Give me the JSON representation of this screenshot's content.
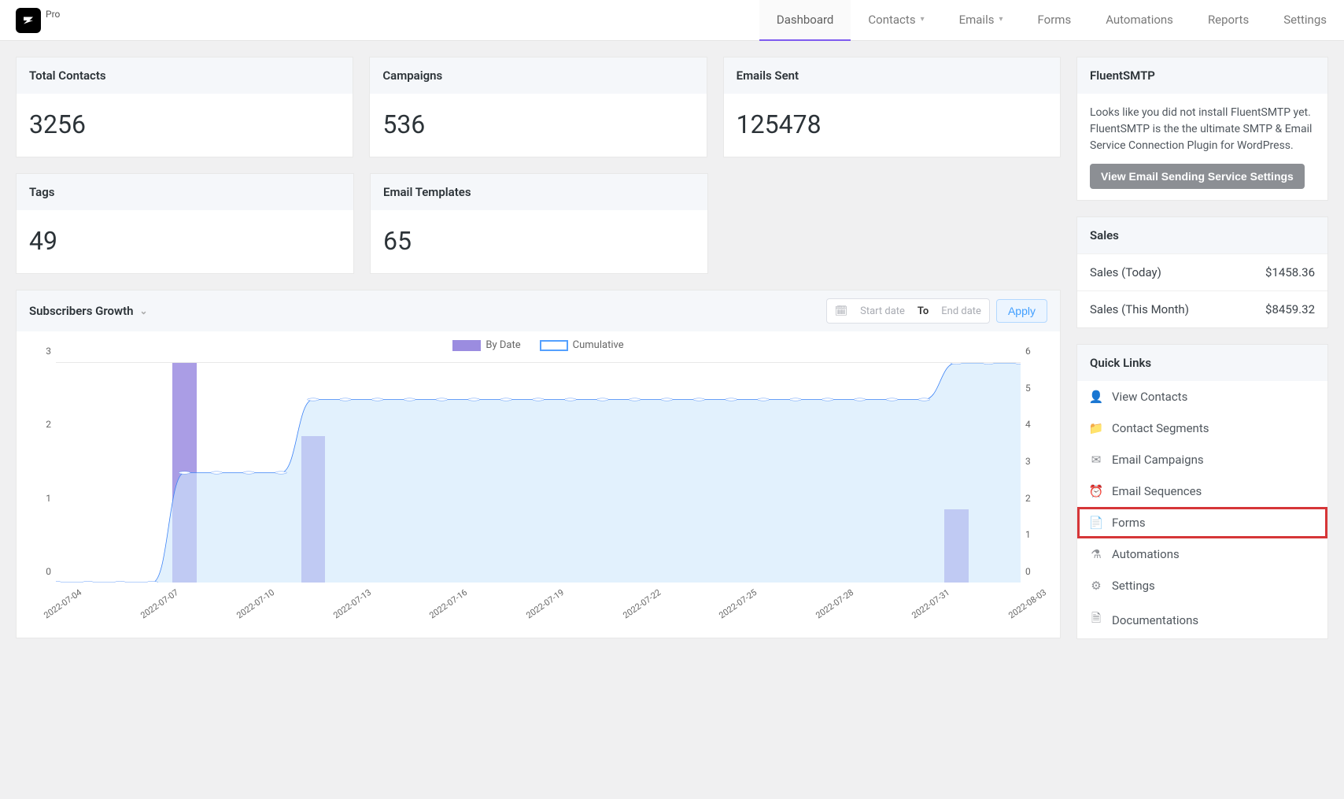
{
  "brand": {
    "pro": "Pro"
  },
  "nav": {
    "dashboard": "Dashboard",
    "contacts": "Contacts",
    "emails": "Emails",
    "forms": "Forms",
    "automations": "Automations",
    "reports": "Reports",
    "settings": "Settings"
  },
  "stats": {
    "total_contacts": {
      "label": "Total Contacts",
      "value": "3256"
    },
    "campaigns": {
      "label": "Campaigns",
      "value": "536"
    },
    "emails_sent": {
      "label": "Emails Sent",
      "value": "125478"
    },
    "tags": {
      "label": "Tags",
      "value": "49"
    },
    "email_templates": {
      "label": "Email Templates",
      "value": "65"
    }
  },
  "chart": {
    "title": "Subscribers Growth",
    "legend_bydate": "By Date",
    "legend_cumulative": "Cumulative",
    "start_placeholder": "Start date",
    "to": "To",
    "end_placeholder": "End date",
    "apply": "Apply"
  },
  "smtp": {
    "title": "FluentSMTP",
    "body": "Looks like you did not install FluentSMTP yet. FluentSMTP is the the ultimate SMTP & Email Service Connection Plugin for WordPress.",
    "button": "View Email Sending Service Settings"
  },
  "sales": {
    "title": "Sales",
    "today_label": "Sales (Today)",
    "today_value": "$1458.36",
    "month_label": "Sales (This Month)",
    "month_value": "$8459.32"
  },
  "quicklinks": {
    "title": "Quick Links",
    "view_contacts": "View Contacts",
    "contact_segments": "Contact Segments",
    "email_campaigns": "Email Campaigns",
    "email_sequences": "Email Sequences",
    "forms": "Forms",
    "automations": "Automations",
    "settings": "Settings",
    "documentations": "Documentations"
  },
  "chart_data": {
    "type": "bar+line",
    "x": [
      "2022-07-04",
      "2022-07-05",
      "2022-07-06",
      "2022-07-07",
      "2022-07-08",
      "2022-07-09",
      "2022-07-10",
      "2022-07-11",
      "2022-07-12",
      "2022-07-13",
      "2022-07-14",
      "2022-07-15",
      "2022-07-16",
      "2022-07-17",
      "2022-07-18",
      "2022-07-19",
      "2022-07-20",
      "2022-07-21",
      "2022-07-22",
      "2022-07-23",
      "2022-07-24",
      "2022-07-25",
      "2022-07-26",
      "2022-07-27",
      "2022-07-28",
      "2022-07-29",
      "2022-07-30",
      "2022-07-31",
      "2022-08-01",
      "2022-08-02",
      "2022-08-03"
    ],
    "x_ticks": [
      "2022-07-04",
      "2022-07-07",
      "2022-07-10",
      "2022-07-13",
      "2022-07-16",
      "2022-07-19",
      "2022-07-22",
      "2022-07-25",
      "2022-07-28",
      "2022-07-31",
      "2022-08-03"
    ],
    "series": [
      {
        "name": "By Date",
        "type": "bar",
        "yaxis": "left",
        "values": [
          0,
          0,
          0,
          0,
          3,
          0,
          0,
          0,
          2,
          0,
          0,
          0,
          0,
          0,
          0,
          0,
          0,
          0,
          0,
          0,
          0,
          0,
          0,
          0,
          0,
          0,
          0,
          0,
          1,
          0,
          0
        ]
      },
      {
        "name": "Cumulative",
        "type": "line",
        "yaxis": "right",
        "values": [
          0,
          0,
          0,
          0,
          3,
          3,
          3,
          3,
          5,
          5,
          5,
          5,
          5,
          5,
          5,
          5,
          5,
          5,
          5,
          5,
          5,
          5,
          5,
          5,
          5,
          5,
          5,
          5,
          6,
          6,
          6
        ]
      }
    ],
    "yaxis_left": {
      "min": 0,
      "max": 3,
      "ticks": [
        0,
        1,
        2,
        3
      ]
    },
    "yaxis_right": {
      "min": 0,
      "max": 6,
      "ticks": [
        0,
        1,
        2,
        3,
        4,
        5,
        6
      ]
    }
  }
}
